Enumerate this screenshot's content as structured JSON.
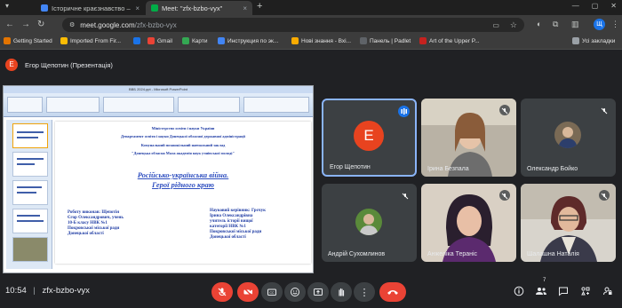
{
  "browser": {
    "tabs": [
      {
        "title": "Історичне краєзнавство – ",
        "favicon_color": "#4285f4",
        "active": false
      },
      {
        "title": "Meet: \"zfx-bzbo-vyx\"",
        "favicon_color": "#00ac47",
        "active": true
      }
    ],
    "new_tab_glyph": "+",
    "close_glyph": "×",
    "url_domain": "meet.google.com",
    "url_path": "/zfx-bzbo-vyx",
    "bookmarks": [
      {
        "label": "Getting Started",
        "color": "#e37400"
      },
      {
        "label": "Imported From Fir...",
        "color": "#fbbc04"
      },
      {
        "label": "Gmail",
        "color": "#ea4335"
      },
      {
        "label": "Карти",
        "color": "#34a853"
      },
      {
        "label": "Инструкция по эк...",
        "color": "#4285f4"
      },
      {
        "label": "Нові знання - Вхі...",
        "color": "#f9ab00"
      },
      {
        "label": "Панель | Padlet",
        "color": "#5f6368"
      },
      {
        "label": "Art of the Upper P...",
        "color": "#c5221f"
      }
    ],
    "all_bookmarks": "Усі закладки",
    "profile_letter": "Щ"
  },
  "meet": {
    "presenter_initial": "Е",
    "presenter_label": "Егор Щепотин (Презентація)",
    "presentation": {
      "window_title": "ВВБ 2024.ppt - Microsoft PowerPoint",
      "slide": {
        "header_lines": [
          "Міністерство освіти і науки України",
          "Департамент освіти і науки Донецької обласної державної адміністрації",
          "Комунальний позашкільний навчальний заклад",
          "\"Донецька обласна Мала академія наук учнівської молоді\""
        ],
        "title_line1": "Російсько-українська війна.",
        "title_line2": "Герої рідного краю",
        "left_col": [
          "Роботу виконав: Щепотін",
          "Єгор Олександрович, учень",
          "10-Б класу НВК №1",
          "Покровської міської ради",
          "Донецької області"
        ],
        "right_col": [
          "Науковий керівник: Грєчук",
          "Ірина Олександрівна",
          "учитель історії вищої",
          "категорії НВК №1",
          "Покровської міської ради",
          "Донецької області"
        ]
      }
    },
    "participants": [
      {
        "name": "Егор Щепотин",
        "initial": "Е",
        "speaking": true
      },
      {
        "name": "Ірина Безпала",
        "muted": true
      },
      {
        "name": "Олександр Бойко",
        "muted": true
      },
      {
        "name": "Андрій Сухомлинов",
        "muted": true
      },
      {
        "name": "Анжеліка Тераніс",
        "muted": true
      },
      {
        "name": "Шалашна Наталія",
        "muted": true
      }
    ],
    "time": "10:54",
    "separator": "|",
    "meeting_code": "zfx-bzbo-vyx",
    "people_count": "7",
    "colors": {
      "end_call": "#ea4335",
      "accent": "#8ab4f8",
      "mic_off": "#ea4335"
    }
  }
}
